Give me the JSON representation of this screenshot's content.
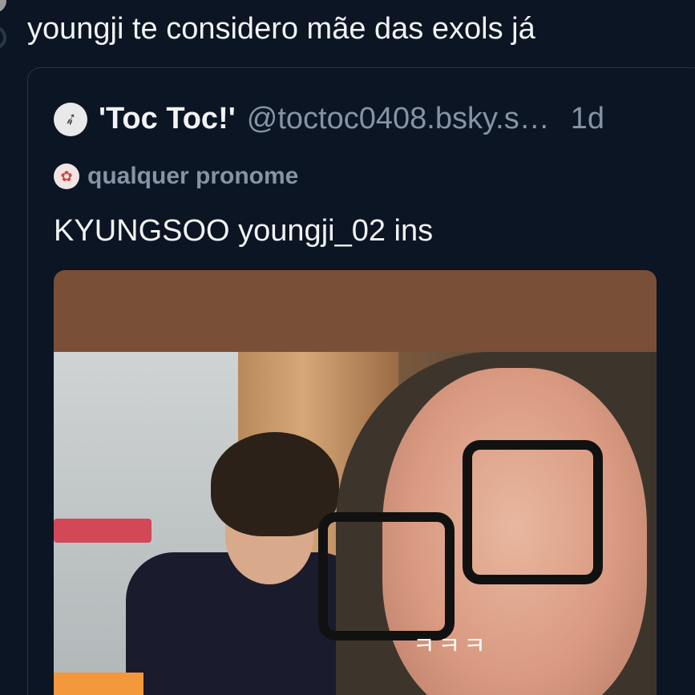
{
  "post": {
    "text": "youngji te considero mãe das exols já"
  },
  "quote": {
    "display_name": "'Toc Toc!'",
    "handle": "@toctoc0408.bsky.s…",
    "time": "1d",
    "label": "qualquer pronome",
    "body": "KYUNGSOO youngji_02 ins",
    "image_caption": "ㅋㅋㅋ"
  },
  "colors": {
    "background": "#0b1524",
    "text": "#f1f3f5",
    "muted": "#8693a4",
    "border": "#263545"
  }
}
